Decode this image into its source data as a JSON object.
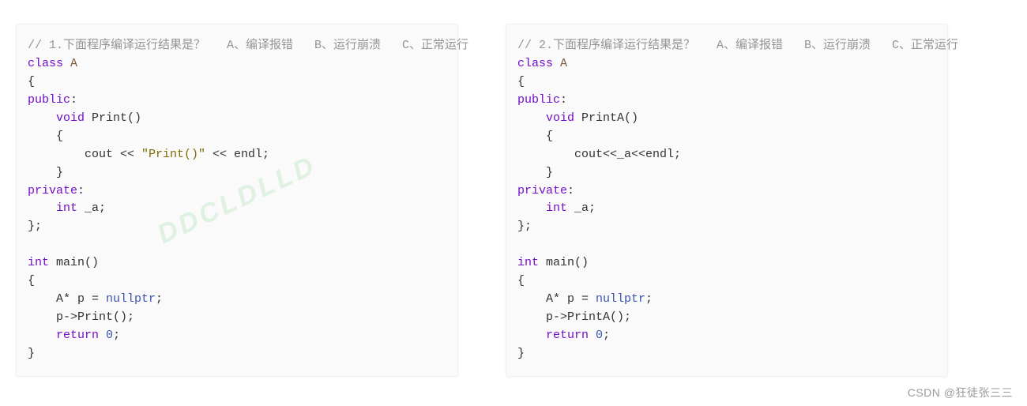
{
  "snippets": {
    "left": {
      "comment": "// 1.下面程序编译运行结果是？   A、编译报错   B、运行崩溃   C、正常运行",
      "class_kw": "class",
      "class_name": " A",
      "lbrace": "{",
      "public_kw": "public",
      "colon1": ":",
      "indent1": "    ",
      "void_kw": "void",
      "fn_name": " Print",
      "fn_paren": "()",
      "indent2": "    {",
      "indent3": "        cout << ",
      "string_lit": "\"Print()\"",
      "after_str": " << endl;",
      "indent4": "    }",
      "private_kw": "private",
      "colon2": ":",
      "indent5": "    ",
      "int_kw": "int",
      "member": " _a;",
      "close_class": "};",
      "blank": "",
      "int_kw2": "int",
      "main_name": " main",
      "main_paren": "()",
      "main_open": "{",
      "line_decl1": "    A* p = ",
      "nullptr_kw": "nullptr",
      "semi1": ";",
      "line_call": "    p->Print();",
      "line_ret1": "    ",
      "return_kw": "return",
      "ret_sp": " ",
      "zero": "0",
      "semi2": ";",
      "main_close": "}"
    },
    "right": {
      "comment": "// 2.下面程序编译运行结果是？   A、编译报错   B、运行崩溃   C、正常运行",
      "class_kw": "class",
      "class_name": " A",
      "lbrace": "{",
      "public_kw": "public",
      "colon1": ":",
      "indent1": "    ",
      "void_kw": "void",
      "fn_name": " PrintA",
      "fn_paren": "()",
      "indent2": "    {",
      "indent3": "        cout<<_a<<endl;",
      "indent4": "    }",
      "private_kw": "private",
      "colon2": ":",
      "indent5": "    ",
      "int_kw": "int",
      "member": " _a;",
      "close_class": "};",
      "blank": "",
      "int_kw2": "int",
      "main_name": " main",
      "main_paren": "()",
      "main_open": "{",
      "line_decl1": "    A* p = ",
      "nullptr_kw": "nullptr",
      "semi1": ";",
      "line_call": "    p->PrintA();",
      "line_ret1": "    ",
      "return_kw": "return",
      "ret_sp": " ",
      "zero": "0",
      "semi2": ";",
      "main_close": "}"
    }
  },
  "watermark": "DDCLDLLD",
  "footer": "CSDN @狂徒张三三"
}
